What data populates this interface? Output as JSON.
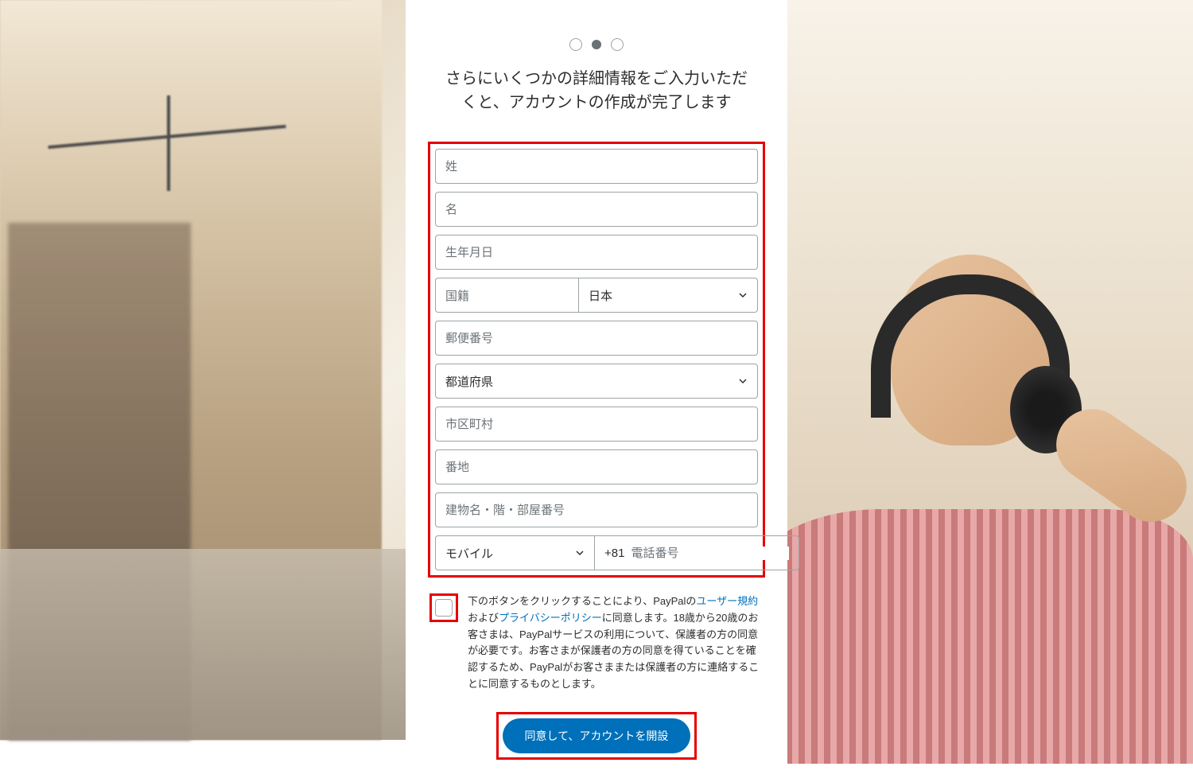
{
  "stepper": {
    "total": 3,
    "active_index": 1
  },
  "heading": "さらにいくつかの詳細情報をご入力いただくと、アカウントの作成が完了します",
  "fields": {
    "last_name": {
      "placeholder": "姓"
    },
    "first_name": {
      "placeholder": "名"
    },
    "birthdate": {
      "placeholder": "生年月日"
    },
    "nationality": {
      "label": "国籍",
      "value": "日本"
    },
    "postal_code": {
      "placeholder": "郵便番号"
    },
    "prefecture": {
      "value": "都道府県"
    },
    "city": {
      "placeholder": "市区町村"
    },
    "street": {
      "placeholder": "番地"
    },
    "building": {
      "placeholder": "建物名・階・部屋番号"
    },
    "phone": {
      "type_value": "モバイル",
      "prefix": "+81",
      "placeholder": "電話番号"
    }
  },
  "consent": {
    "text_1": "下のボタンをクリックすることにより、PayPalの",
    "link_1": "ユーザー規約",
    "text_2": "および",
    "link_2": "プライバシーポリシー",
    "text_3": "に同意します。18歳から20歳のお客さまは、PayPalサービスの利用について、保護者の方の同意が必要です。お客さまが保護者の方の同意を得ていることを確認するため、PayPalがお客さままたは保護者の方に連絡することに同意するものとします。"
  },
  "submit": {
    "label": "同意して、アカウントを開設"
  }
}
